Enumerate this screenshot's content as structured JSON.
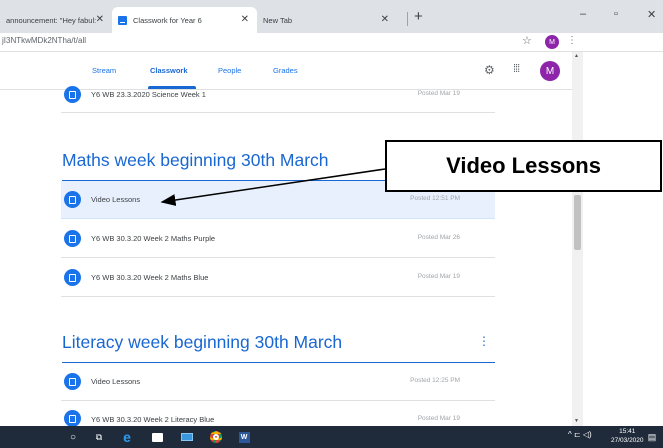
{
  "browser": {
    "tabs": [
      {
        "label": "announcement: \"Hey fabul:",
        "close": "✕"
      },
      {
        "label": "Classwork for Year 6",
        "close": "✕"
      },
      {
        "label": "New Tab",
        "close": "✕"
      }
    ],
    "new_tab": "+",
    "window_controls": {
      "minimize": "–",
      "maximize": "▫",
      "close": "✕"
    },
    "url": "jI3NTkwMDk2NTha/t/all",
    "profile_initial": "M"
  },
  "classroom": {
    "nav_tabs": [
      "Stream",
      "Classwork",
      "People",
      "Grades"
    ],
    "active_tab": "Classwork",
    "avatar_initial": "M"
  },
  "items_top": [
    {
      "title": "Y6 WB 23.3.2020 Science Week 1",
      "posted": "Posted Mar 19"
    }
  ],
  "topics": [
    {
      "title": "Maths week beginning 30th March",
      "items": [
        {
          "title": "Video Lessons",
          "posted": "Posted 12:51 PM"
        },
        {
          "title": "Y6 WB 30.3.20 Week 2 Maths Purple",
          "posted": "Posted Mar 26"
        },
        {
          "title": "Y6 WB 30.3.20 Week 2 Maths Blue",
          "posted": "Posted Mar 19"
        }
      ]
    },
    {
      "title": "Literacy week beginning 30th March",
      "menu": "⋮",
      "items": [
        {
          "title": "Video Lessons",
          "posted": "Posted 12:25 PM"
        },
        {
          "title": "Y6 WB 30.3.20 Week 2 Literacy Blue",
          "posted": "Posted Mar 19"
        }
      ]
    }
  ],
  "callout": {
    "text": "Video Lessons"
  },
  "taskbar": {
    "time": "15:41",
    "date": "27/03/2020",
    "tray": "^ ⊏ ◁)"
  },
  "colors": {
    "accent": "#1967d2",
    "highlight": "#e8f0fe",
    "taskbar": "#1f2b3b",
    "avatar": "#8e24aa"
  }
}
